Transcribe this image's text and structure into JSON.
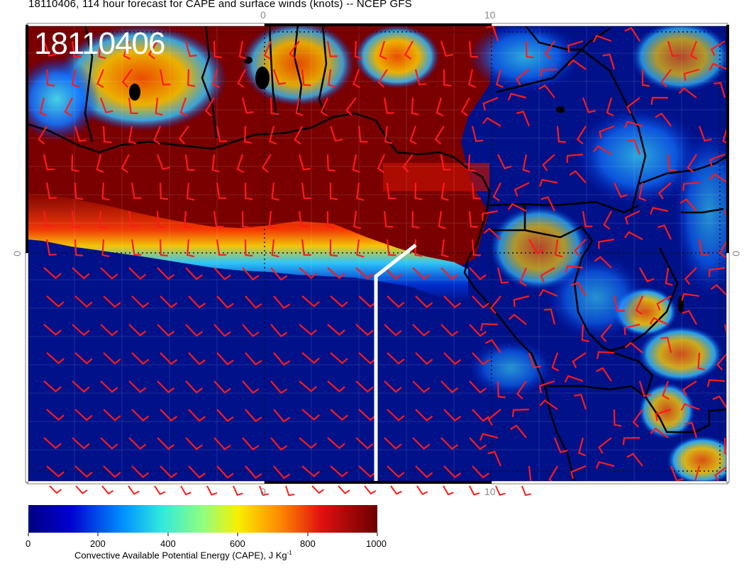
{
  "title": "18110406, 114 hour forecast for CAPE and surface winds (knots) -- NCEP GFS",
  "stamp": "18110406",
  "axis": {
    "top_ticks": [
      "0",
      "10"
    ],
    "bottom_ticks": [
      "0",
      "10"
    ],
    "left_tick": "0",
    "right_tick": "0"
  },
  "colorbar": {
    "ticks": [
      "0",
      "200",
      "400",
      "600",
      "800",
      "1000"
    ],
    "title_main": "Convective Available Potential Energy (CAPE), J Kg",
    "title_sup": "-1",
    "colors": [
      "#00007f",
      "#0000ff",
      "#00bfff",
      "#7fffb2",
      "#ffff00",
      "#ff7f00",
      "#ff0000",
      "#7f0000"
    ]
  },
  "map_colors": {
    "ocean_low": "#00118a",
    "high_cape": "#7a0000",
    "wind_barb": "#ff1a1a",
    "coastline": "#000000",
    "track": "#ffffff",
    "grid_dotted": "#111111"
  }
}
